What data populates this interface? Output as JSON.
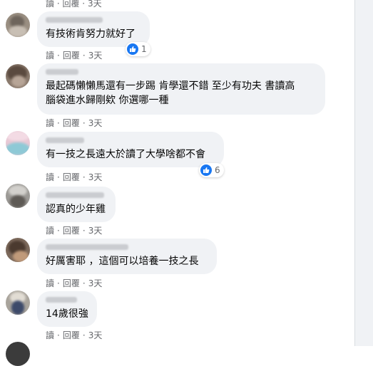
{
  "action_labels": {
    "reply": "回覆",
    "read": "讀"
  },
  "top_row": {
    "read": "讀",
    "reply": "回覆",
    "time": "3天"
  },
  "comments": [
    {
      "text": "有技術肯努力就好了",
      "time": "3天",
      "reactions": "1"
    },
    {
      "text": "最起碼懶懶馬還有一步踢 肯學還不錯 至少有功夫 書讀高\n腦袋進水歸剛欸 你選哪一種",
      "time": "3天"
    },
    {
      "text": "有一技之長遠大於讀了大學啥都不會",
      "time": "3天",
      "reactions": "6"
    },
    {
      "text": "認真的少年雞",
      "time": "3天"
    },
    {
      "text": "好厲害耶 ，這個可以培養一技之長",
      "time": "3天"
    },
    {
      "text": "14歲很強",
      "time": "3天"
    }
  ],
  "colors": {
    "bubble": "#f0f2f5",
    "like": "#1877f2",
    "meta": "#65676b"
  }
}
